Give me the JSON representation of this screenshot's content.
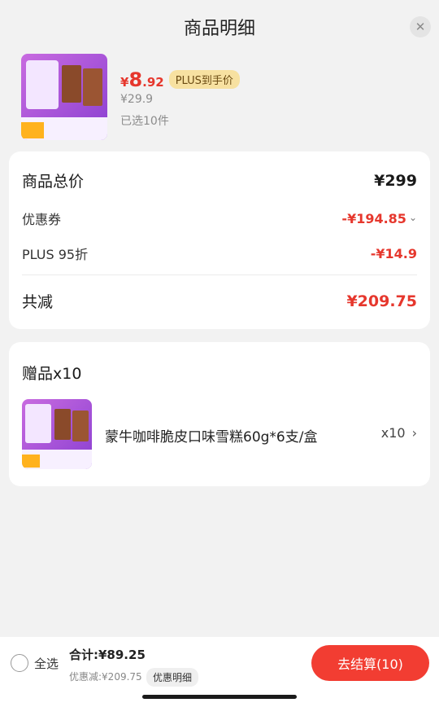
{
  "header": {
    "title": "商品明细",
    "close_icon": "✕"
  },
  "product": {
    "currency": "¥",
    "price_int": "8",
    "price_dec": ".92",
    "plus_tag": "PLUS到手价",
    "orig_price": "¥29.9",
    "selected_count": "已选10件"
  },
  "summary": {
    "total_label": "商品总价",
    "total_value": "¥299",
    "coupon_label": "优惠券",
    "coupon_value": "-¥194.85",
    "plus_label": "PLUS 95折",
    "plus_value": "-¥14.9",
    "reduce_label": "共减",
    "reduce_value": "¥209.75"
  },
  "gifts": {
    "title": "赠品x10",
    "item_name": "蒙牛咖啡脆皮口味雪糕60g*6支/盒",
    "item_qty": "x10"
  },
  "footer": {
    "select_all": "全选",
    "total": "合计:¥89.25",
    "discount": "优惠减:¥209.75",
    "detail_chip": "优惠明细",
    "checkout": "去结算(10)"
  },
  "colors": {
    "accent_red": "#e6372d",
    "plus_gold": "#f7e1a1"
  }
}
